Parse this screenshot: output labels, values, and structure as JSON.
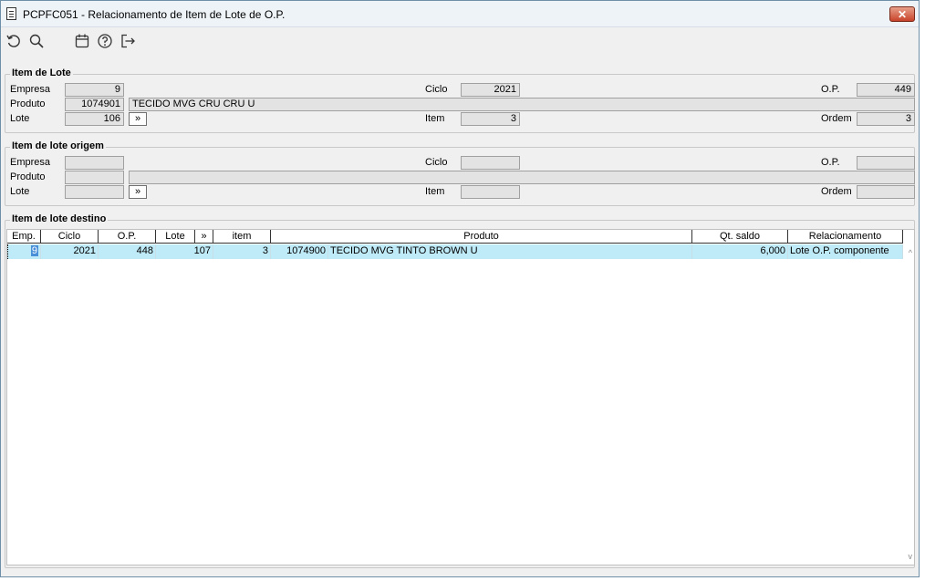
{
  "window": {
    "title": "PCPFC051 - Relacionamento de Item de Lote de O.P.",
    "close_glyph": "✕"
  },
  "toolbar": {
    "icons": [
      "refresh-icon",
      "search-icon",
      "calendar-icon",
      "help-icon",
      "exit-icon"
    ]
  },
  "item_lote": {
    "title": "Item de Lote",
    "labels": {
      "empresa": "Empresa",
      "produto": "Produto",
      "lote": "Lote",
      "ciclo": "Ciclo",
      "item": "Item",
      "op": "O.P.",
      "ordem": "Ordem"
    },
    "values": {
      "empresa": "9",
      "produto_code": "1074901",
      "produto_desc": "TECIDO MVG CRU CRU U",
      "lote": "106",
      "ciclo": "2021",
      "item": "3",
      "op": "449",
      "ordem": "3"
    },
    "arrow_label": "»"
  },
  "item_origem": {
    "title": "Item de lote origem",
    "labels": {
      "empresa": "Empresa",
      "produto": "Produto",
      "lote": "Lote",
      "ciclo": "Ciclo",
      "item": "Item",
      "op": "O.P.",
      "ordem": "Ordem"
    },
    "arrow_label": "»"
  },
  "destino": {
    "title": "Item de lote destino",
    "columns": {
      "emp": "Emp.",
      "ciclo": "Ciclo",
      "op": "O.P.",
      "lote": "Lote",
      "arrow": "»",
      "item": "item",
      "produto": "Produto",
      "qt_saldo": "Qt. saldo",
      "relacionamento": "Relacionamento"
    },
    "rows": [
      {
        "emp": "9",
        "ciclo": "2021",
        "op": "448",
        "lote": "107",
        "item": "3",
        "produto_code": "1074900",
        "produto_desc": "TECIDO MVG TINTO BROWN U",
        "qt_saldo": "6,000",
        "relacionamento": "Lote O.P. componente"
      }
    ]
  }
}
